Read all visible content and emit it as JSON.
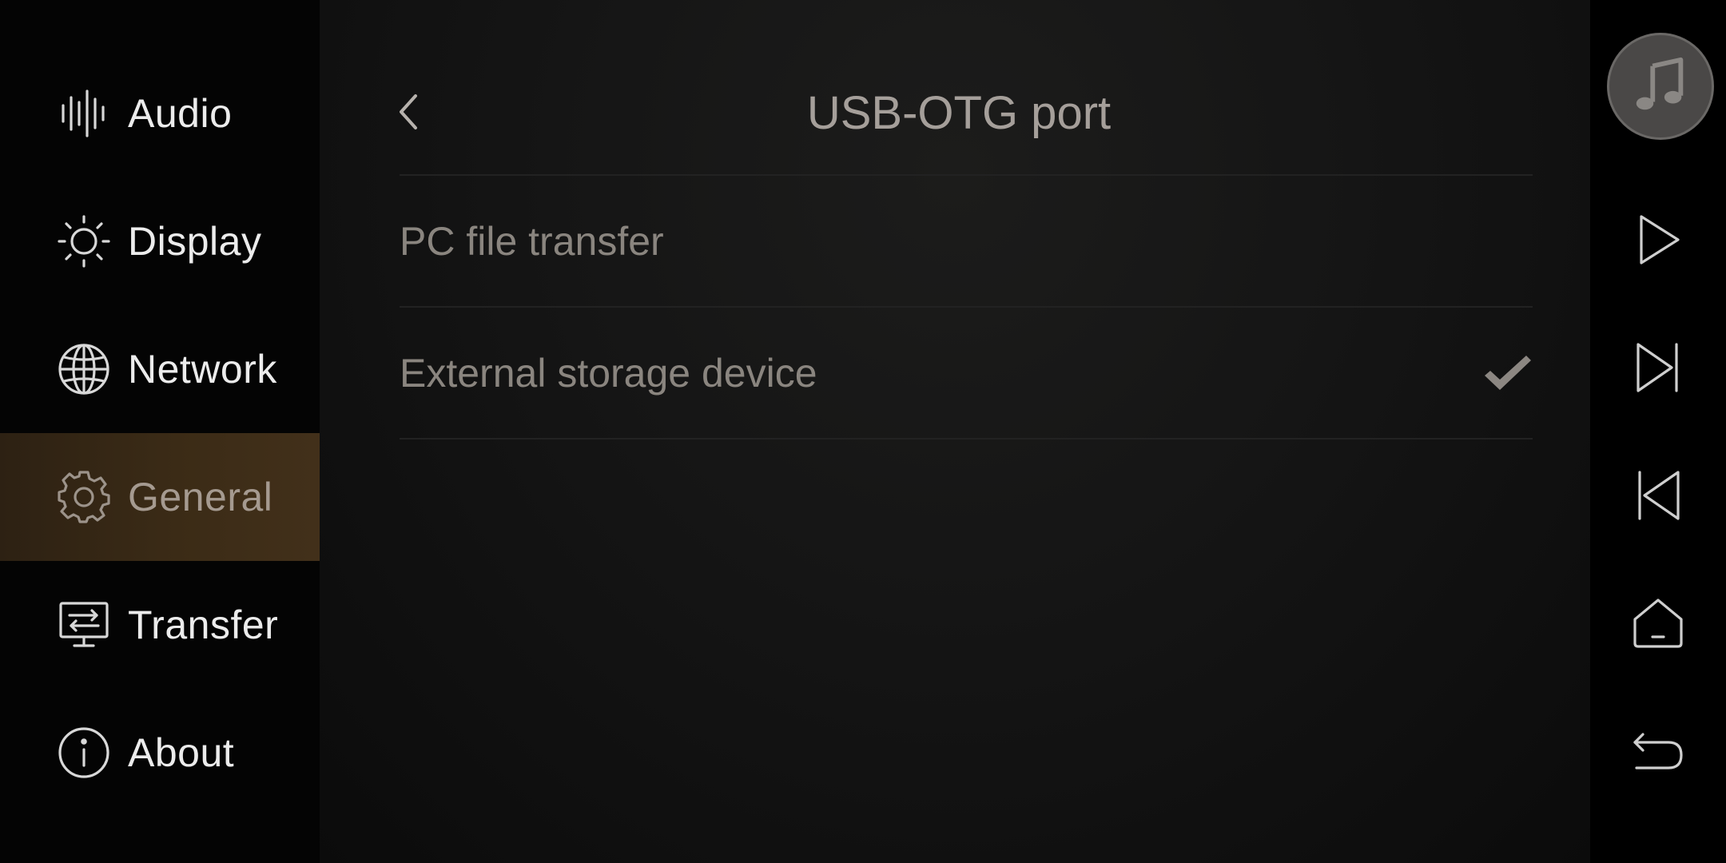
{
  "sidebar": {
    "items": [
      {
        "label": "Audio",
        "icon": "audio-waveform-icon",
        "active": false
      },
      {
        "label": "Display",
        "icon": "sun-icon",
        "active": false
      },
      {
        "label": "Network",
        "icon": "globe-icon",
        "active": false
      },
      {
        "label": "General",
        "icon": "gear-icon",
        "active": true
      },
      {
        "label": "Transfer",
        "icon": "transfer-monitor-icon",
        "active": false
      },
      {
        "label": "About",
        "icon": "info-icon",
        "active": false
      }
    ]
  },
  "header": {
    "title": "USB-OTG port",
    "back_icon": "chevron-left-icon"
  },
  "options": [
    {
      "label": "PC file transfer",
      "selected": false
    },
    {
      "label": "External storage device",
      "selected": true
    }
  ],
  "rail": {
    "now_playing_icon": "music-note-icon",
    "buttons": [
      "play-icon",
      "next-track-icon",
      "previous-track-icon",
      "home-icon",
      "back-arrow-icon"
    ]
  },
  "colors": {
    "active_nav_bg": "#3b2b16",
    "text_primary": "#ececec",
    "text_muted": "#8a857f",
    "title": "#a59f9a"
  }
}
